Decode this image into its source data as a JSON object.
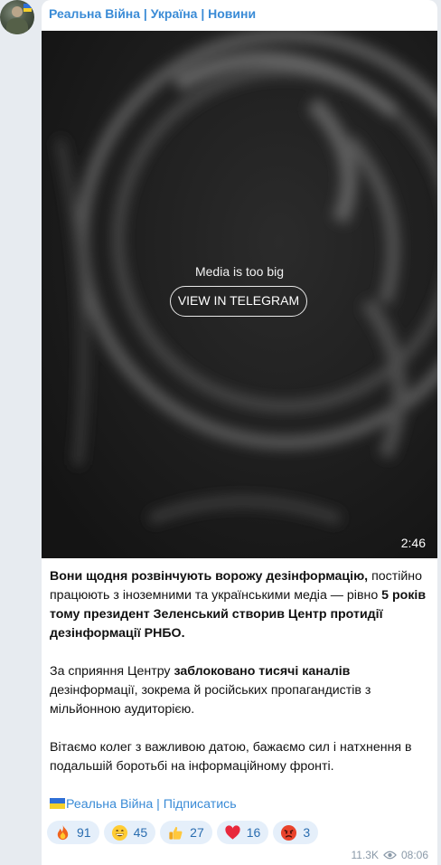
{
  "channel": {
    "name": "Реальна Війна | Україна | Новини"
  },
  "media": {
    "message": "Media is too big",
    "button_label": "VIEW IN TELEGRAM",
    "duration": "2:46"
  },
  "post": {
    "p1_bold1": "Вони щодня розвінчують ворожу дезінформацію,",
    "p1_text1": " постійно працюють з іноземними та українськими медіа — рівно ",
    "p1_bold2": "5 років тому президент Зеленський створив Центр протидії дезінформації РНБО.",
    "p2_text1": "За сприяння Центру ",
    "p2_bold1": "заблоковано тисячі каналів",
    "p2_text2": " дезінформації, зокрема й російських пропагандистів з мільйонною аудиторією.",
    "p3_text1": "Вітаємо колег з важливою датою, бажаємо сил і натхнення в подальшій боротьбі на інформаційному фронті.",
    "signature": "Реальна Війна | Підписатись"
  },
  "reactions": [
    {
      "icon": "fire-emoji-icon",
      "count": "91"
    },
    {
      "icon": "grinning-face-emoji-icon",
      "count": "45"
    },
    {
      "icon": "thumbs-up-emoji-icon",
      "count": "27"
    },
    {
      "icon": "red-heart-emoji-icon",
      "count": "16"
    },
    {
      "icon": "angry-face-emoji-icon",
      "count": "3"
    }
  ],
  "meta": {
    "views": "11.3K",
    "time": "08:06"
  },
  "colors": {
    "link": "#3a8bd6",
    "reaction_bg": "#e5effa",
    "reaction_text": "#2a6db0",
    "meta": "#8a99a8",
    "page_bg": "#e7ebf0"
  }
}
